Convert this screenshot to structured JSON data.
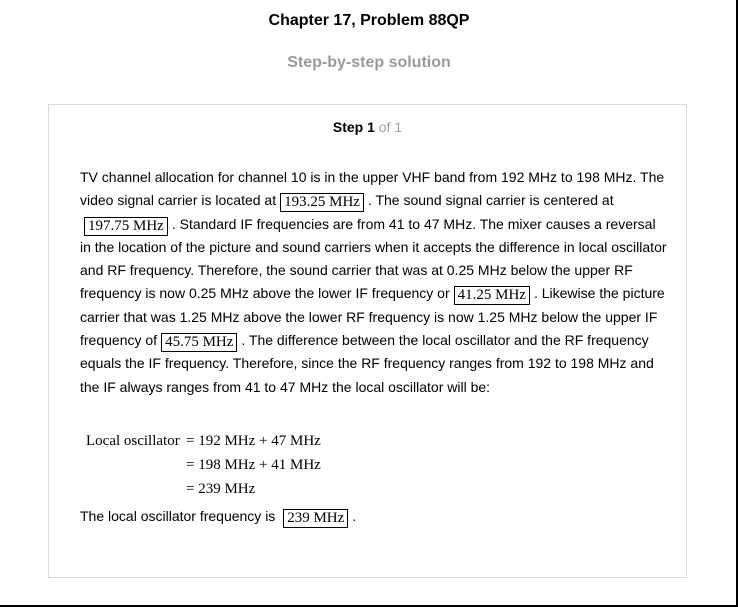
{
  "header": {
    "title": "Chapter 17, Problem 88QP",
    "subtitle": "Step-by-step solution"
  },
  "step": {
    "word": "Step",
    "number": "1",
    "of_text": "of 1"
  },
  "solution": {
    "seg1": "TV channel allocation for channel 10 is in the upper VHF band from 192 MHz to 198 MHz. The video signal carrier is located at",
    "box1": "193.25 MHz",
    "seg2": ". The sound signal carrier is centered at",
    "box2": "197.75 MHz",
    "seg3": ". Standard IF frequencies are from 41 to 47 MHz. The mixer causes a reversal in the location of the picture and sound carriers when it accepts the difference in local oscillator and RF frequency. Therefore, the sound carrier that was at 0.25 MHz below the upper RF frequency is now 0.25 MHz above the lower IF frequency or",
    "box3": "41.25 MHz",
    "seg4": ". Likewise the picture carrier that was 1.25 MHz above the lower RF frequency is now 1.25 MHz below the upper IF frequency of",
    "box4": "45.75 MHz",
    "seg5": ". The difference between the local oscillator and the RF frequency equals the IF frequency. Therefore, since the RF frequency ranges from 192 to 198 MHz and the IF always ranges from 41 to 47 MHz the local oscillator will be:"
  },
  "equation": {
    "label": "Local oscillator",
    "line1": "= 192 MHz + 47 MHz",
    "line2": "= 198 MHz + 41 MHz",
    "line3": "= 239 MHz"
  },
  "conclusion": {
    "text": "The local oscillator frequency is",
    "answer": "239 MHz",
    "end": "."
  }
}
